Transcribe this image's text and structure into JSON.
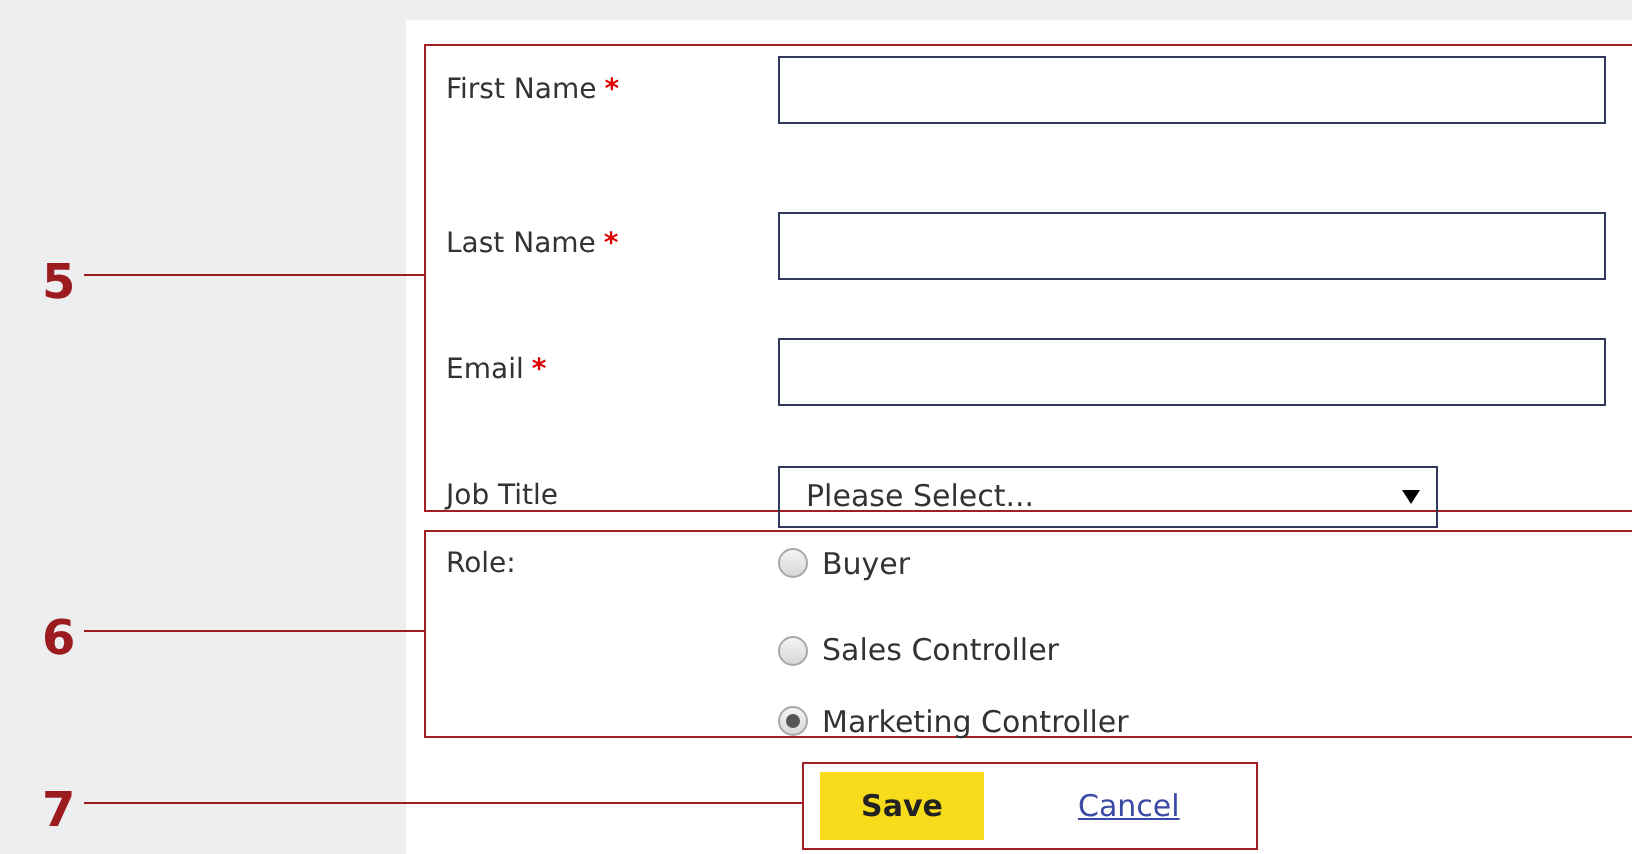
{
  "callouts": [
    {
      "number": "5"
    },
    {
      "number": "6"
    },
    {
      "number": "7"
    }
  ],
  "fields": [
    {
      "label": "First Name",
      "required_mark": "*",
      "kind": "text"
    },
    {
      "label": "Last Name",
      "required_mark": "*",
      "kind": "text"
    },
    {
      "label": "Email",
      "required_mark": "*",
      "kind": "text"
    },
    {
      "label": "Job Title",
      "kind": "select",
      "value": "Please Select..."
    }
  ],
  "role": {
    "label": "Role:",
    "options": [
      {
        "label": "Buyer",
        "selected": false
      },
      {
        "label": "Sales Controller",
        "selected": false
      },
      {
        "label": "Marketing Controller",
        "selected": true
      }
    ]
  },
  "actions": {
    "save": "Save",
    "cancel": "Cancel"
  }
}
